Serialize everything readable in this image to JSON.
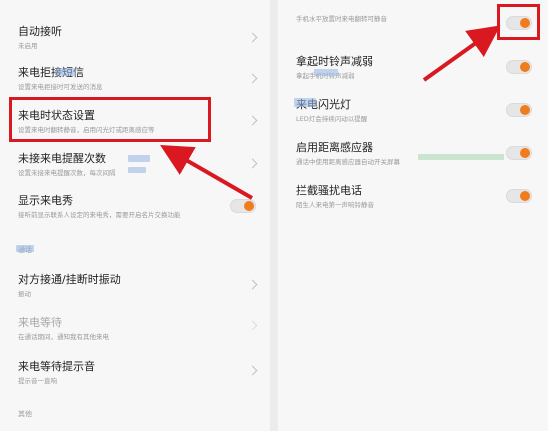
{
  "left": {
    "auto_answer": {
      "title": "自动接听",
      "sub": "未启用"
    },
    "reject_sms": {
      "title": "来电拒接短信",
      "sub": "设置来电拒接时可发送的消息"
    },
    "incall_state": {
      "title": "来电时状态设置",
      "sub": "设置来电时翻转静音，启用闪光灯或距离感应等"
    },
    "missed_reminder": {
      "title": "未接来电提醒次数",
      "sub": "设置未接来电提醒次数，每次间隔"
    },
    "caller_show": {
      "title": "显示来电秀",
      "sub": "接听前显示联系人设定的来电秀，需要开启名片交换功能"
    },
    "section_call": "通话",
    "vibrate": {
      "title": "对方接通/挂断时振动",
      "sub": "振动"
    },
    "call_waiting": {
      "title": "来电等待",
      "sub": "在通话期间，通知我有其他来电"
    },
    "waiting_tone": {
      "title": "来电等待提示音",
      "sub": "提示音一直响"
    },
    "section_other": "其他"
  },
  "right": {
    "flip_mute": {
      "sub": "手机水平放置时来电翻转可静音"
    },
    "pickup_reduce": {
      "title": "拿起时铃声减弱",
      "sub": "拿起手机时铃声减弱"
    },
    "flash": {
      "title": "来电闪光灯",
      "sub": "LED灯会持续闪动以提醒"
    },
    "proximity": {
      "title": "启用距离感应器",
      "sub": "通话中使用距离感应器自动开关屏幕"
    },
    "block_spam": {
      "title": "拦截骚扰电话",
      "sub": "陌生人来电第一声响铃静音"
    }
  },
  "colors": {
    "accent": "#f07c1e",
    "highlight": "#d9181f"
  }
}
